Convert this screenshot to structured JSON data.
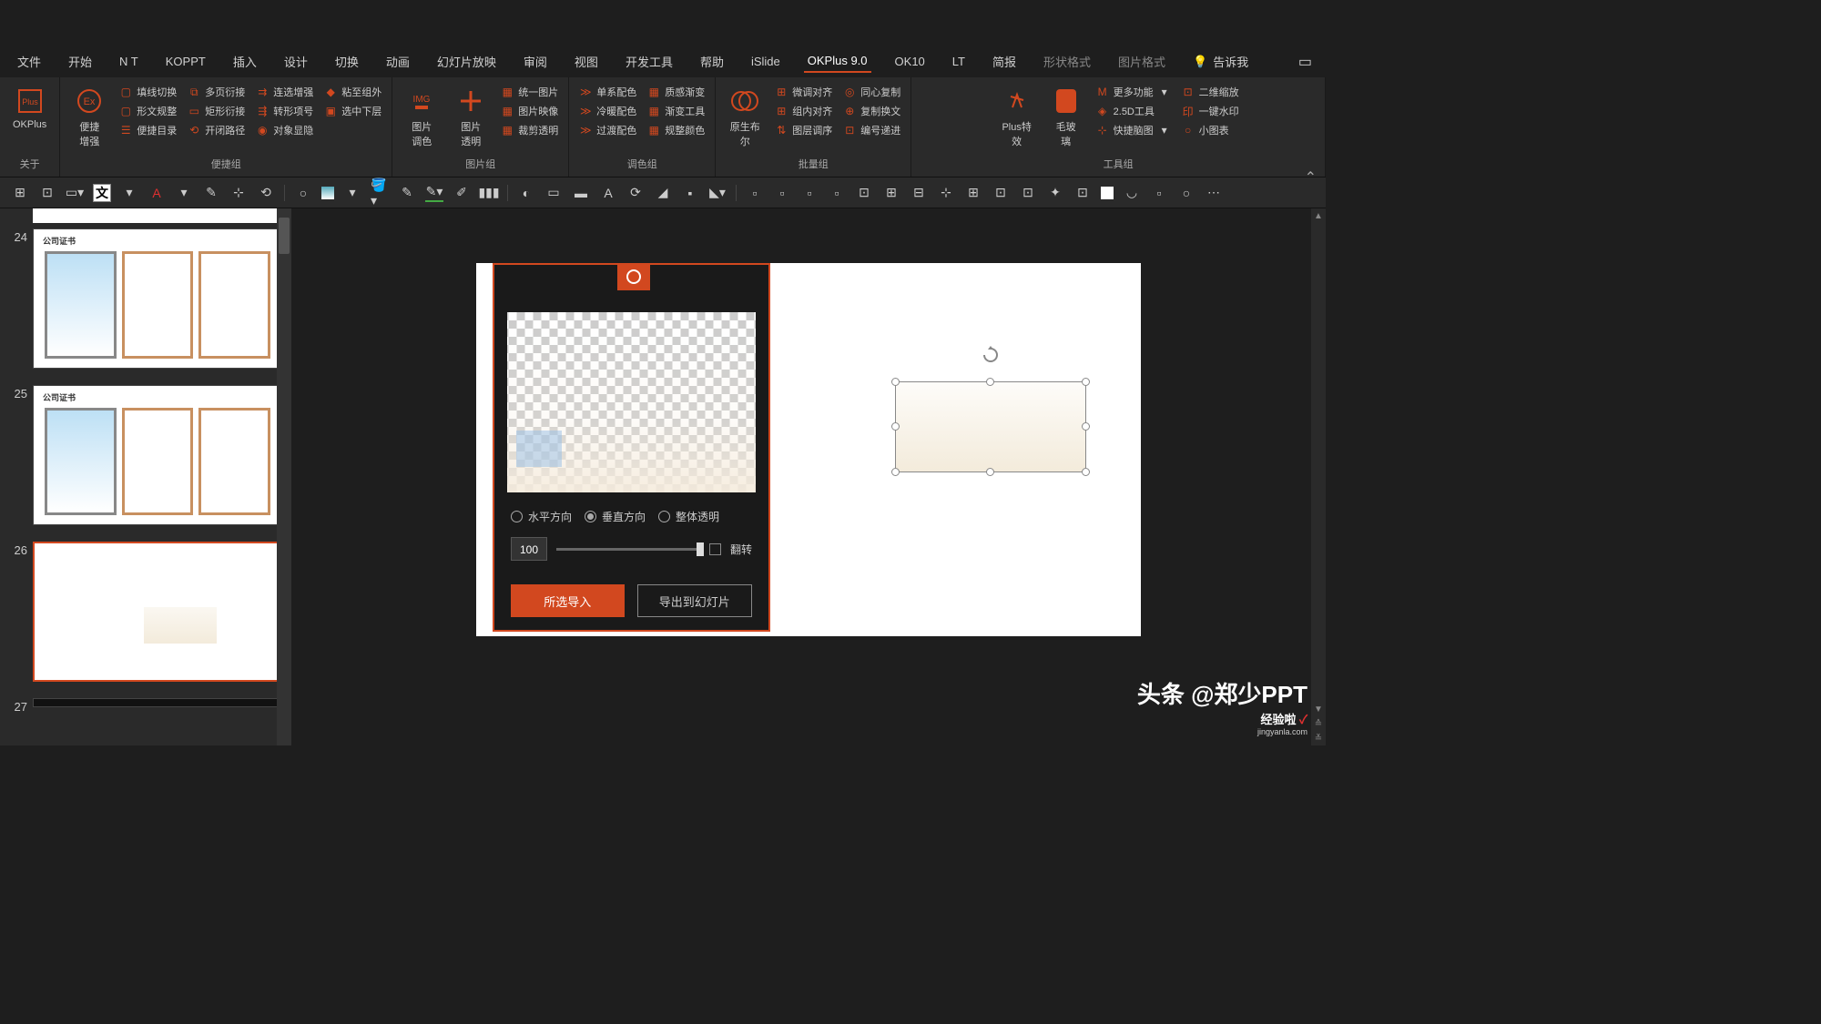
{
  "tabs": {
    "file": "文件",
    "home": "开始",
    "nt": "N T",
    "koppt": "KOPPT",
    "insert": "插入",
    "design": "设计",
    "transition": "切换",
    "animation": "动画",
    "slideshow": "幻灯片放映",
    "review": "审阅",
    "view": "视图",
    "devtools": "开发工具",
    "help": "帮助",
    "islide": "iSlide",
    "okplus": "OKPlus 9.0",
    "ok10": "OK10",
    "lt": "LT",
    "jianbao": "简报",
    "shapefmt": "形状格式",
    "picfmt": "图片格式",
    "tellme": "告诉我"
  },
  "ribbon": {
    "group1": {
      "okplus": "OKPlus",
      "about": "关于",
      "enhance": "便捷\n增强"
    },
    "group2": {
      "label": "便捷组",
      "items": [
        "填线切换",
        "多页衍接",
        "连选增强",
        "粘至组外",
        "形文规整",
        "矩形衍接",
        "转形项号",
        "选中下层",
        "便捷目录",
        "开闭路径",
        "对象显隐"
      ]
    },
    "group3": {
      "label": "图片组",
      "pic_adjust": "图片\n调色",
      "pic_trans": "图片\n透明",
      "items": [
        "统一图片",
        "图片映像",
        "裁剪透明"
      ]
    },
    "group4": {
      "label": "调色组",
      "items": [
        "单系配色",
        "质感渐变",
        "冷暖配色",
        "渐变工具",
        "过渡配色",
        "规整颜色"
      ]
    },
    "group5": {
      "label": "批量组",
      "yuansheng": "原生布\n尔",
      "items": [
        "微调对齐",
        "同心复制",
        "组内对齐",
        "复制换文",
        "图层调序",
        "编号递进"
      ]
    },
    "group6": {
      "label": "工具组",
      "plus_fx": "Plus特\n效",
      "maoboli": "毛玻\n璃",
      "items": [
        "更多功能",
        "二维缩放",
        "2.5D工具",
        "一键水印",
        "快捷脑图",
        "小图表"
      ]
    }
  },
  "thumbs": {
    "n23_partial": "",
    "n24": "24",
    "n25": "25",
    "n26": "26",
    "n27": "27",
    "cert_title": "公司证书"
  },
  "panel": {
    "radio_h": "水平方向",
    "radio_v": "垂直方向",
    "radio_all": "整体透明",
    "value": "100",
    "flip": "翻转",
    "import": "所选导入",
    "export": "导出到幻灯片"
  },
  "watermark": {
    "line1": "头条 @郑少PPT",
    "brand": "经验啦",
    "domain": "jingyanla.com"
  },
  "colors": {
    "accent": "#d2481f"
  }
}
